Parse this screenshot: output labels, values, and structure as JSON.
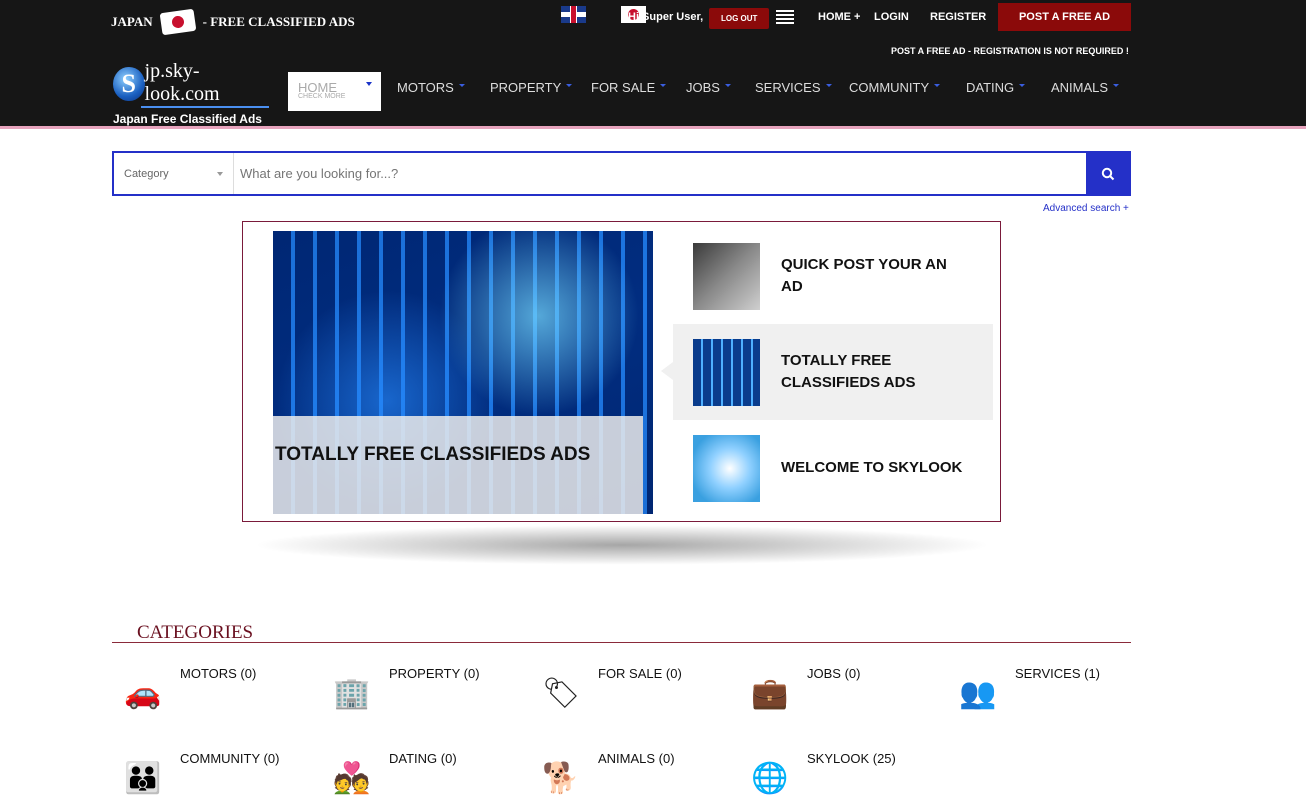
{
  "header": {
    "country": "JAPAN",
    "tagline": "- FREE CLASSIFIED ADS",
    "greeting": "Hi Super User,",
    "logout": "LOG OUT",
    "home": "HOME +",
    "login": "LOGIN",
    "register": "REGISTER",
    "post_ad": "POST A FREE AD",
    "notice": "POST A FREE AD - REGISTRATION IS NOT REQUIRED !"
  },
  "logo": {
    "letter": "S",
    "domain": "jp.sky-look.com",
    "subtitle": "Japan Free Classified Ads"
  },
  "nav": {
    "home": "HOME",
    "home_sub": "CHECK MORE",
    "items": [
      "MOTORS",
      "PROPERTY",
      "FOR SALE",
      "JOBS",
      "SERVICES",
      "COMMUNITY",
      "DATING",
      "ANIMALS"
    ]
  },
  "search": {
    "category": "Category",
    "placeholder": "What are you looking for...?",
    "advanced": "Advanced search +"
  },
  "slider": {
    "main_caption": "TOTALLY FREE CLASSIFIEDS ADS",
    "items": [
      "QUICK POST YOUR AN AD",
      "TOTALLY FREE CLASSIFIEDS ADS",
      "WELCOME TO SKYLOOK"
    ],
    "active_index": 1
  },
  "categories": {
    "heading": "CATEGORIES",
    "items": [
      {
        "label": "MOTORS (0)",
        "icon": "car-icon",
        "glyph": "🚗"
      },
      {
        "label": "PROPERTY (0)",
        "icon": "building-icon",
        "glyph": "🏢"
      },
      {
        "label": "FOR SALE (0)",
        "icon": "sale-tag-icon",
        "glyph": "🏷"
      },
      {
        "label": "JOBS (0)",
        "icon": "jobs-icon",
        "glyph": "💼"
      },
      {
        "label": "SERVICES (1)",
        "icon": "services-icon",
        "glyph": "👥"
      },
      {
        "label": "COMMUNITY (0)",
        "icon": "community-icon",
        "glyph": "👪"
      },
      {
        "label": "DATING (0)",
        "icon": "dating-icon",
        "glyph": "💑"
      },
      {
        "label": "ANIMALS (0)",
        "icon": "animals-icon",
        "glyph": "🐕"
      },
      {
        "label": "SKYLOOK (25)",
        "icon": "globe-icon",
        "glyph": "🌐"
      }
    ]
  }
}
